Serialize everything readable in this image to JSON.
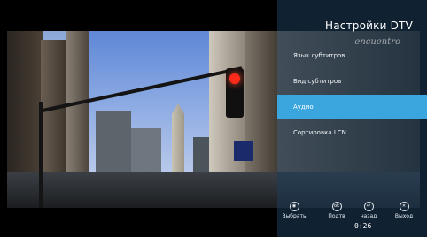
{
  "panel": {
    "title": "Настройки DTV",
    "brand_watermark": "encuentro"
  },
  "menu": {
    "items": [
      {
        "label": "Язык субтитров",
        "selected": false
      },
      {
        "label": "Вид субтитров",
        "selected": false
      },
      {
        "label": "Аудио",
        "selected": true
      },
      {
        "label": "Сортировка LCN",
        "selected": false
      }
    ]
  },
  "footer": {
    "hints": [
      {
        "label": "Выбрать",
        "icon": "ok-icon"
      },
      {
        "label": "Подтв",
        "icon": "ok-confirm-icon"
      },
      {
        "label": "назад",
        "icon": "back-icon"
      },
      {
        "label": "Выход",
        "icon": "exit-icon"
      }
    ],
    "time": "0:26"
  },
  "colors": {
    "selection": "#3ba6dd",
    "panel_overlay": "rgba(30,60,90,0.55)",
    "traffic_light": "#ff2a1a"
  }
}
